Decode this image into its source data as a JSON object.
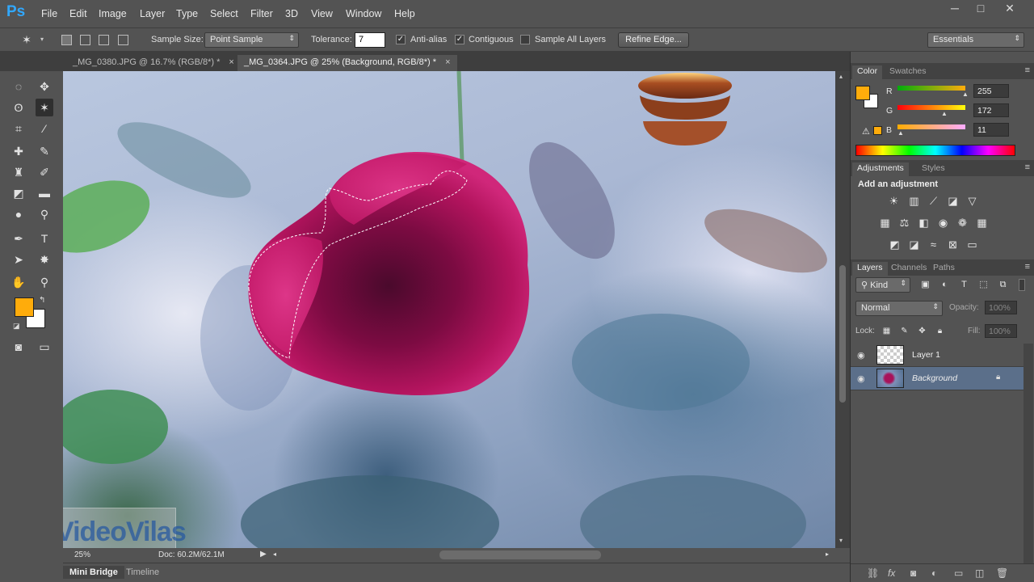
{
  "app": {
    "logo": "Ps"
  },
  "menu": [
    "File",
    "Edit",
    "Image",
    "Layer",
    "Type",
    "Select",
    "Filter",
    "3D",
    "View",
    "Window",
    "Help"
  ],
  "window_controls": {
    "minimize": "─",
    "maximize": "□",
    "close": "✕"
  },
  "options": {
    "sample_size_label": "Sample Size:",
    "sample_size_value": "Point Sample",
    "tolerance_label": "Tolerance:",
    "tolerance_value": "7",
    "antialias_label": "Anti-alias",
    "antialias_checked": "✓",
    "contiguous_label": "Contiguous",
    "contiguous_checked": "✓",
    "sample_all_label": "Sample All Layers",
    "sample_all_checked": "",
    "refine_edge": "Refine Edge...",
    "workspace": "Essentials"
  },
  "tabs": [
    {
      "label": "_MG_0380.JPG @ 16.7% (RGB/8*) *",
      "close": "×"
    },
    {
      "label": "_MG_0364.JPG @ 25% (Background, RGB/8*) *",
      "close": "×"
    }
  ],
  "colors": {
    "foreground": "#ffac0b",
    "background": "#ffffff"
  },
  "status": {
    "zoom": "25%",
    "doc": "Doc: 60.2M/62.1M"
  },
  "bottom_tabs": [
    "Mini Bridge",
    "Timeline"
  ],
  "watermark": {
    "text": "VideoVilas"
  },
  "color_panel": {
    "tabs": [
      "Color",
      "Swatches"
    ],
    "channels": [
      {
        "label": "R",
        "value": "255"
      },
      {
        "label": "G",
        "value": "172"
      },
      {
        "label": "B",
        "value": "11"
      }
    ]
  },
  "adjustments_panel": {
    "tabs": [
      "Adjustments",
      "Styles"
    ],
    "title": "Add an adjustment"
  },
  "layers_panel": {
    "tabs": [
      "Layers",
      "Channels",
      "Paths"
    ],
    "filter": "Kind",
    "blend_mode": "Normal",
    "opacity_label": "Opacity:",
    "opacity_value": "100%",
    "lock_label": "Lock:",
    "fill_label": "Fill:",
    "fill_value": "100%",
    "layers": [
      {
        "name": "Layer 1"
      },
      {
        "name": "Background"
      }
    ]
  }
}
